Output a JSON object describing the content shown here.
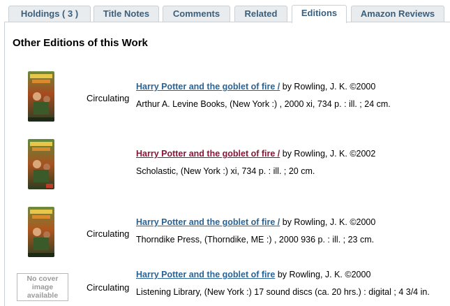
{
  "tabs": [
    {
      "label": "Holdings ( 3 )",
      "active": false
    },
    {
      "label": "Title Notes",
      "active": false
    },
    {
      "label": "Comments",
      "active": false
    },
    {
      "label": "Related",
      "active": false
    },
    {
      "label": "Editions",
      "active": true
    },
    {
      "label": "Amazon Reviews",
      "active": false
    }
  ],
  "section": {
    "heading": "Other Editions of this Work"
  },
  "editions": [
    {
      "status": "Circulating",
      "title": "Harry Potter and the goblet of fire /",
      "byline": " by Rowling, J. K. ©2000",
      "publication": "Arthur A. Levine Books, (New York :) , 2000 xi, 734 p. : ill. ; 24 cm.",
      "cover": "book-cover"
    },
    {
      "status": "",
      "title": "Harry Potter and the goblet of fire /",
      "byline": " by Rowling, J. K. ©2002",
      "publication": "Scholastic, (New York :) xi, 734 p. : ill. ; 20 cm.",
      "cover": "book-cover"
    },
    {
      "status": "Circulating",
      "title": "Harry Potter and the goblet of fire /",
      "byline": " by Rowling, J. K. ©2000",
      "publication": "Thorndike Press, (Thorndike, ME :) , 2000 936 p. : ill. ; 23 cm.",
      "cover": "book-cover"
    },
    {
      "status": "Circulating",
      "title": "Harry Potter and the goblet of fire",
      "byline": " by Rowling, J. K. ©2000",
      "publication": "Listening Library, (New York :) 17 sound discs (ca. 20 hrs.) : digital ; 4 3/4 in.",
      "cover_text": "No cover\nimage\navailable"
    }
  ],
  "colors": {
    "link": "#2a6496",
    "visited_link": "#8a1538",
    "tab_text": "#3a5f7d",
    "tab_bg": "#e8ecef"
  }
}
